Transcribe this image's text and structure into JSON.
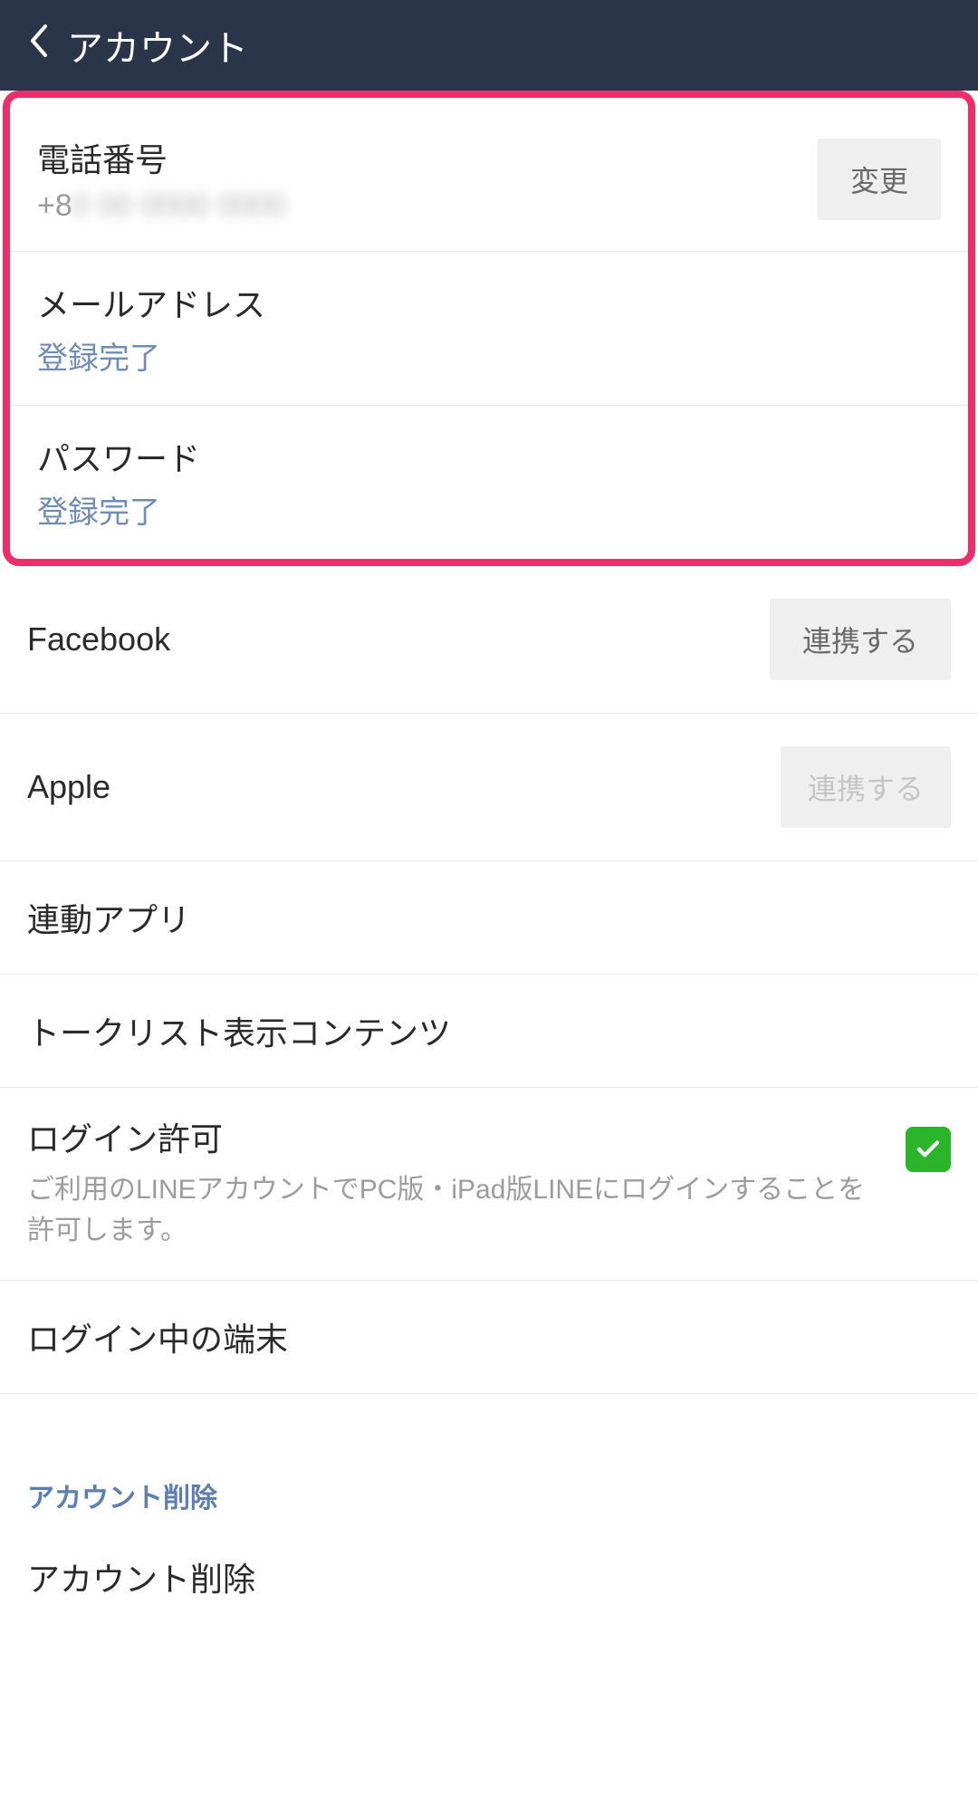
{
  "header": {
    "title": "アカウント"
  },
  "phone": {
    "label": "電話番号",
    "value_prefix": "+8",
    "value_hidden": "0 00 0000 0000",
    "button": "変更"
  },
  "email": {
    "label": "メールアドレス",
    "status": "登録完了"
  },
  "password": {
    "label": "パスワード",
    "status": "登録完了"
  },
  "facebook": {
    "label": "Facebook",
    "button": "連携する"
  },
  "apple": {
    "label": "Apple",
    "button": "連携する"
  },
  "linked_apps": {
    "label": "連動アプリ"
  },
  "talk_list": {
    "label": "トークリスト表示コンテンツ"
  },
  "login_permission": {
    "label": "ログイン許可",
    "description": "ご利用のLINEアカウントでPC版・iPad版LINEにログインすることを許可します。"
  },
  "logged_devices": {
    "label": "ログイン中の端末"
  },
  "account_delete_section": {
    "title": "アカウント削除",
    "label": "アカウント削除"
  }
}
